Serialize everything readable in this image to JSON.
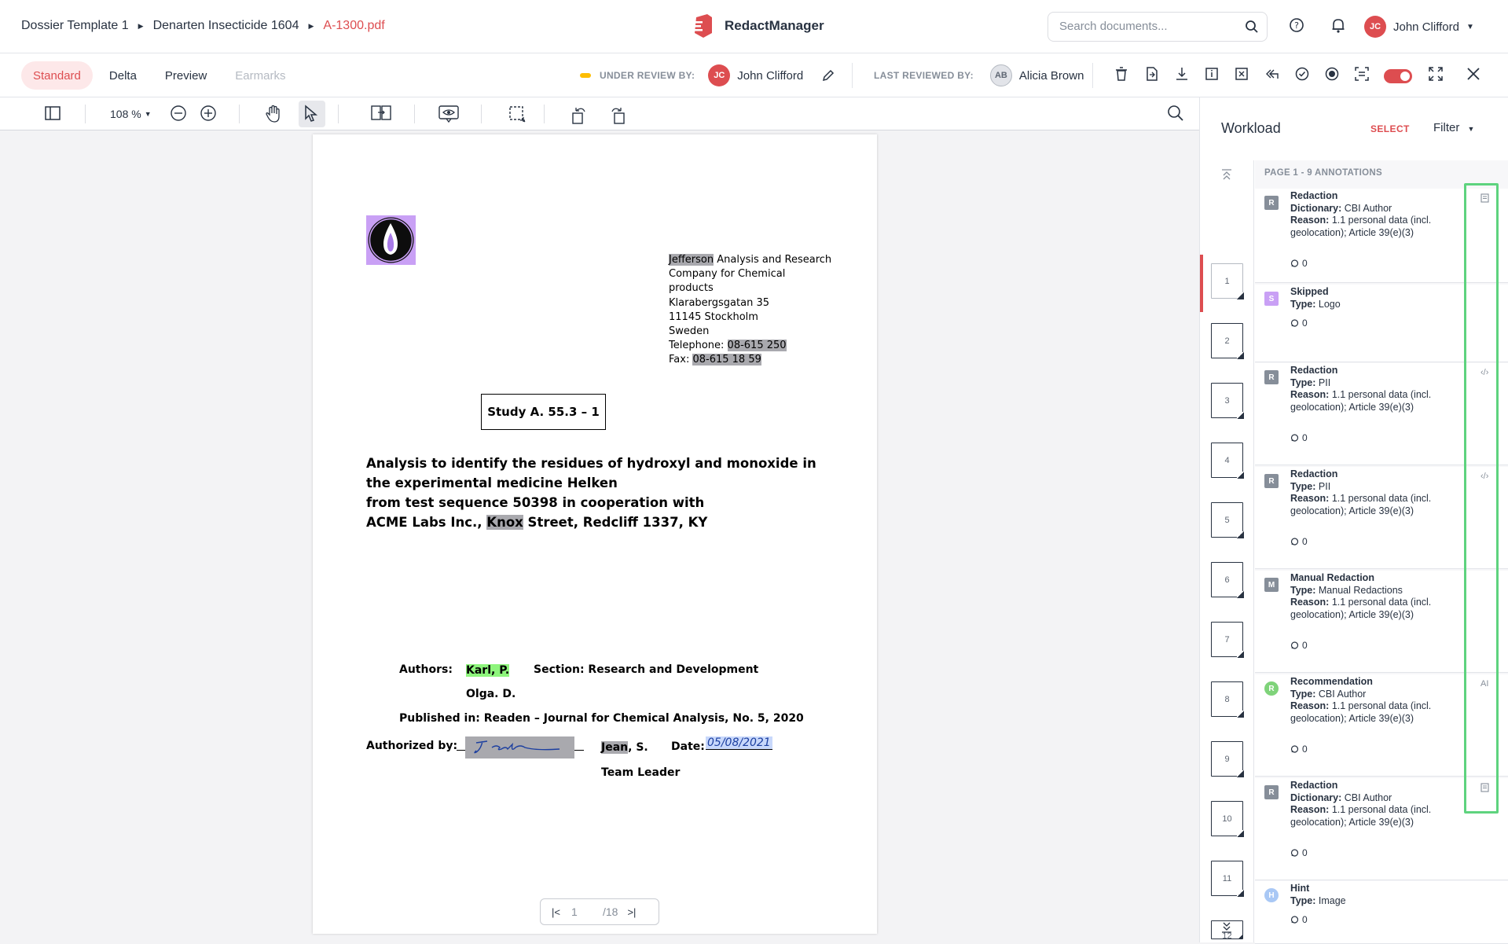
{
  "breadcrumb": {
    "items": [
      "Dossier Template 1",
      "Denarten Insecticide 1604"
    ],
    "current": "A-1300.pdf"
  },
  "app": {
    "name": "RedactManager"
  },
  "search": {
    "placeholder": "Search documents..."
  },
  "user": {
    "initials": "JC",
    "name": "John Clifford"
  },
  "view_tabs": [
    {
      "label": "Standard",
      "state": "selected"
    },
    {
      "label": "Delta",
      "state": "normal"
    },
    {
      "label": "Preview",
      "state": "normal"
    },
    {
      "label": "Earmarks",
      "state": "disabled"
    }
  ],
  "review": {
    "under_review_label": "UNDER REVIEW BY:",
    "reviewer_initials": "JC",
    "reviewer_name": "John Clifford",
    "last_reviewed_label": "LAST REVIEWED BY:",
    "last_initials": "AB",
    "last_name": "Alicia Brown"
  },
  "viewer": {
    "zoom": "108 %",
    "current_page": "1",
    "total_pages": "/18"
  },
  "document": {
    "address": {
      "company_highlight": "Jefferson",
      "company_rest": " Analysis and Research",
      "line2": "Company for Chemical",
      "line3": "products",
      "line4": "Klarabergsgatan 35",
      "line5": "11145 Stockholm",
      "line6": "Sweden",
      "tel_label": "Telephone: ",
      "tel_value": "08-615 250",
      "fax_label": "Fax: ",
      "fax_value": "08-615 18 59"
    },
    "study": "Study A. 55.3 – 1",
    "title_l1": "Analysis to identify the residues of hydroxyl and monoxide in",
    "title_l2": "the experimental medicine Helken",
    "title_l3": "from test sequence 50398 in cooperation with",
    "title_l4a": "ACME Labs Inc., ",
    "title_l4b": "Knox",
    "title_l4c": " Street, Redcliff 1337, KY",
    "authors_label": "Authors:",
    "author1": "Karl, P.",
    "section": "Section: Research and Development",
    "author2": "Olga. D.",
    "published": "Published in: Readen – Journal for Chemical Analysis, No. 5, 2020",
    "authorized_label": "Authorized by:",
    "signer_hl": "Jean",
    "signer_rest": ", S.",
    "date_label": "Date:",
    "date_value": "05/08/2021",
    "team_leader": "Team Leader"
  },
  "workload": {
    "title": "Workload",
    "select": "SELECT",
    "filter": "Filter",
    "page_header": "PAGE 1 - 9 ANNOTATIONS",
    "thumbnails": [
      "1",
      "2",
      "3",
      "4",
      "5",
      "6",
      "7",
      "8",
      "9",
      "10",
      "11",
      "12"
    ],
    "annotations": [
      {
        "badge": "R",
        "badge_color": "#868e99",
        "title": "Redaction",
        "field": "Dictionary:",
        "field_value": " CBI Author",
        "reason": "1.1 personal data (incl. geolocation); Article 39(e)(3)",
        "comments": "0",
        "right_icon": "document-icon"
      },
      {
        "badge": "S",
        "badge_color": "#c9a0f5",
        "title": "Skipped",
        "field": "Type:",
        "field_value": " Logo",
        "reason": "",
        "comments": "0",
        "right_icon": ""
      },
      {
        "badge": "R",
        "badge_color": "#868e99",
        "title": "Redaction",
        "field": "Type:",
        "field_value": " PII",
        "reason": "1.1 personal data (incl. geolocation); Article 39(e)(3)",
        "comments": "0",
        "right_icon": "code-icon"
      },
      {
        "badge": "R",
        "badge_color": "#868e99",
        "title": "Redaction",
        "field": "Type:",
        "field_value": " PII",
        "reason": "1.1 personal data (incl. geolocation); Article 39(e)(3)",
        "comments": "0",
        "right_icon": "code-icon"
      },
      {
        "badge": "M",
        "badge_color": "#868e99",
        "title": "Manual Redaction",
        "field": "Type:",
        "field_value": " Manual Redactions",
        "reason": "1.1 personal data (incl. geolocation); Article 39(e)(3)",
        "comments": "0",
        "right_icon": ""
      },
      {
        "badge": "R",
        "badge_color": "#7fd37a",
        "title": "Recommendation",
        "field": "Type:",
        "field_value": " CBI Author",
        "reason": "1.1 personal data (incl. geolocation); Article 39(e)(3)",
        "comments": "0",
        "right_icon": "AI"
      },
      {
        "badge": "R",
        "badge_color": "#868e99",
        "title": "Redaction",
        "field": "Dictionary:",
        "field_value": " CBI Author",
        "reason": "1.1 personal data (incl. geolocation); Article 39(e)(3)",
        "comments": "0",
        "right_icon": "document-icon"
      },
      {
        "badge": "H",
        "badge_color": "#a9c8f5",
        "title": "Hint",
        "field": "Type:",
        "field_value": " Image",
        "reason": "",
        "comments": "0",
        "right_icon": ""
      }
    ],
    "reason_label": "Reason:"
  },
  "colors": {
    "accent": "#dd4d50",
    "review_dot": "#fdbd00",
    "highlight": "#a9a9ae",
    "recommendation": "#8ef57c"
  }
}
